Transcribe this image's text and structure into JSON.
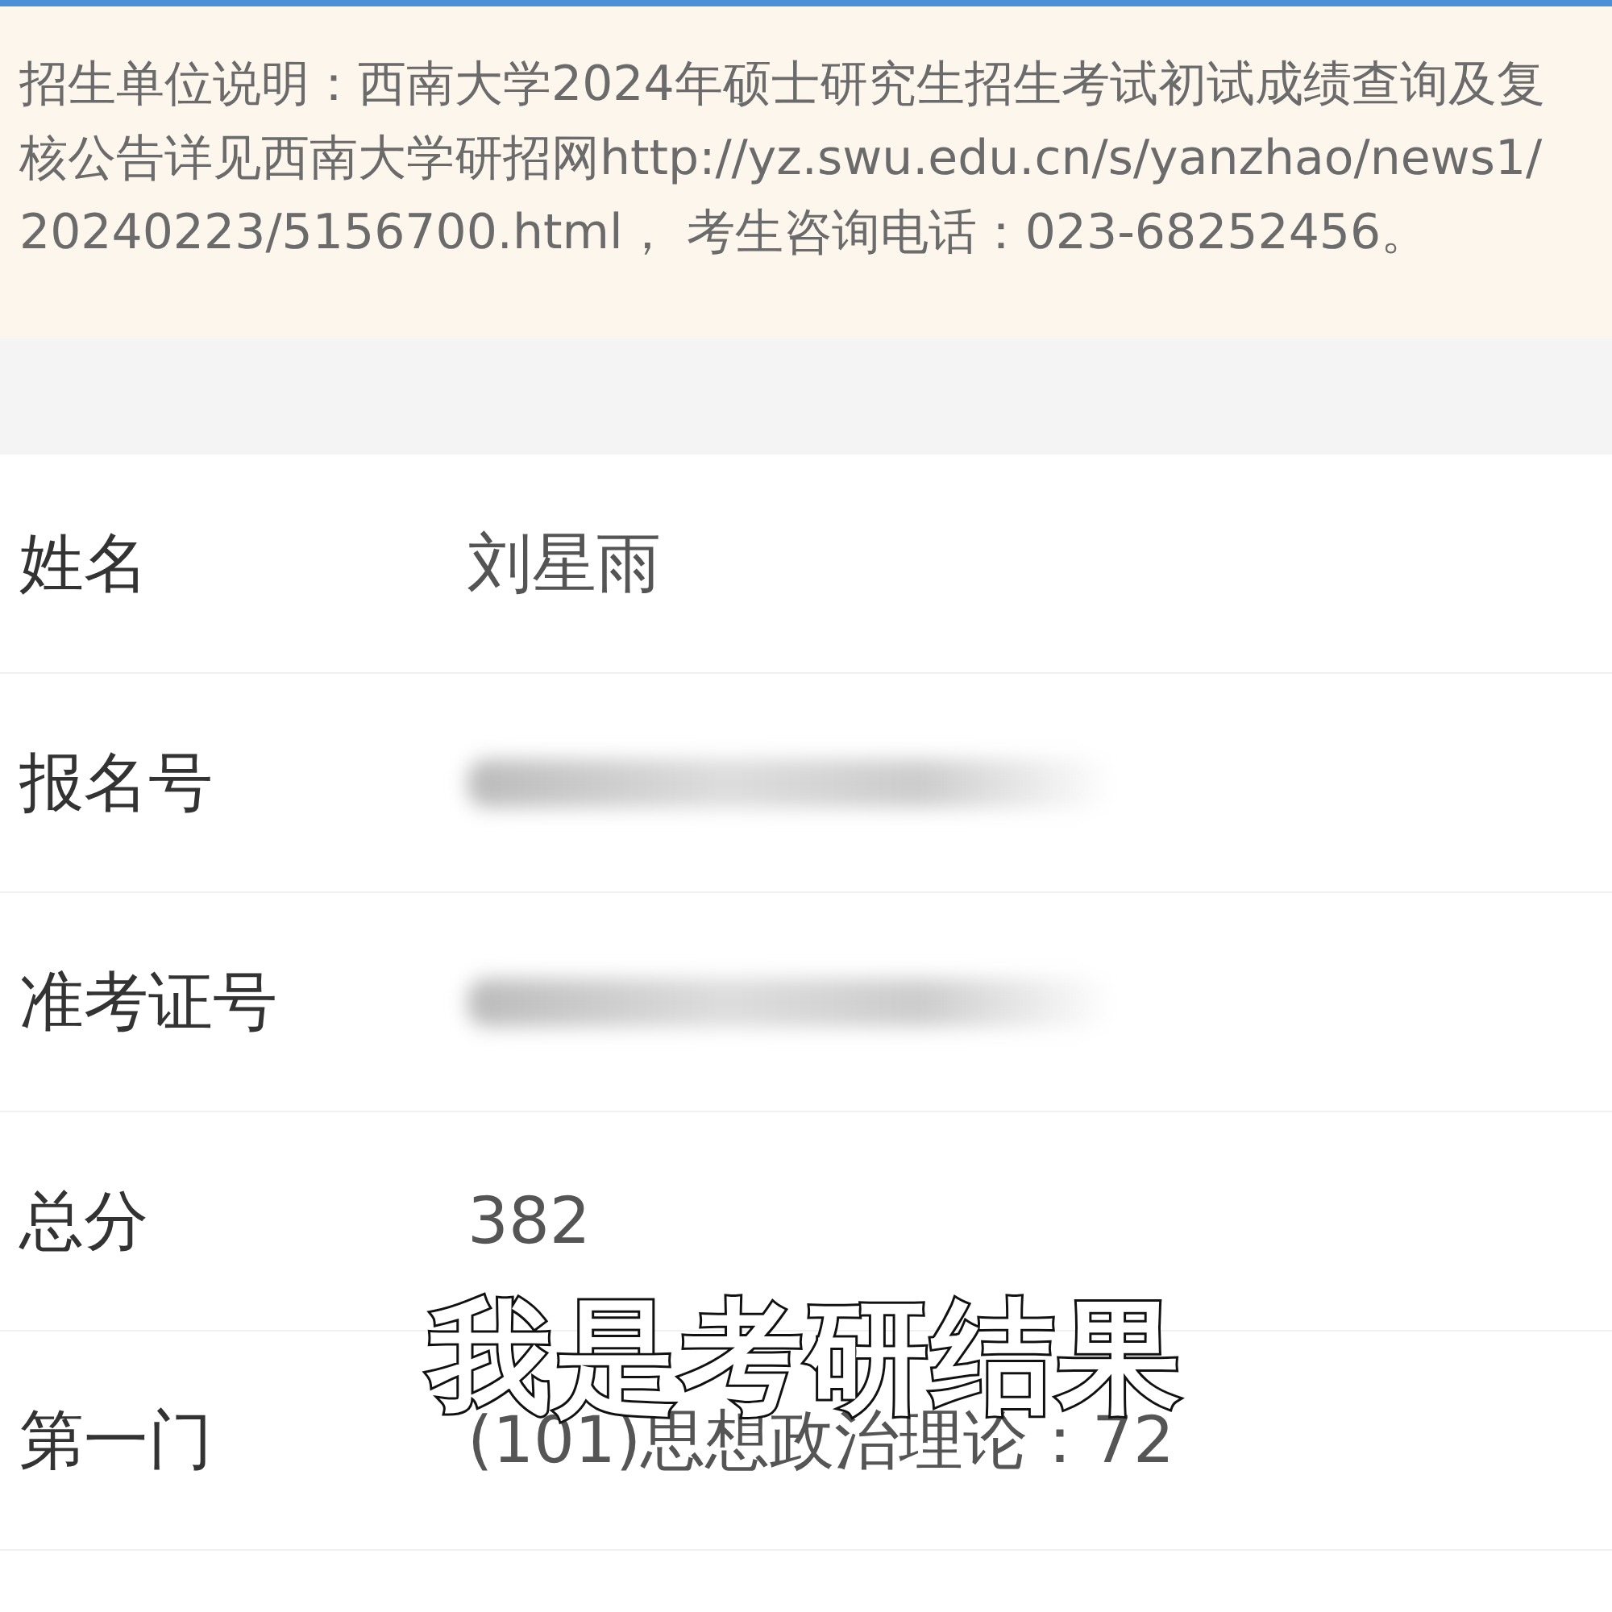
{
  "notice": {
    "text": "招生单位说明：西南大学2024年硕士研究生招生考试初试成绩查询及复核公告详见西南大学研招网http://yz.swu.edu.cn/s/yanzhao/news1/20240223/5156700.html， 考生咨询电话：023-68252456。"
  },
  "rows": [
    {
      "label": "姓名",
      "kind": "text",
      "value": "刘星雨"
    },
    {
      "label": "报名号",
      "kind": "blurred"
    },
    {
      "label": "准考证号",
      "kind": "blurred"
    },
    {
      "label": "总分",
      "kind": "text",
      "value": "382"
    },
    {
      "label": "第一门",
      "kind": "text",
      "value": "(101)思想政治理论：72"
    }
  ],
  "caption": "我是考研结果"
}
